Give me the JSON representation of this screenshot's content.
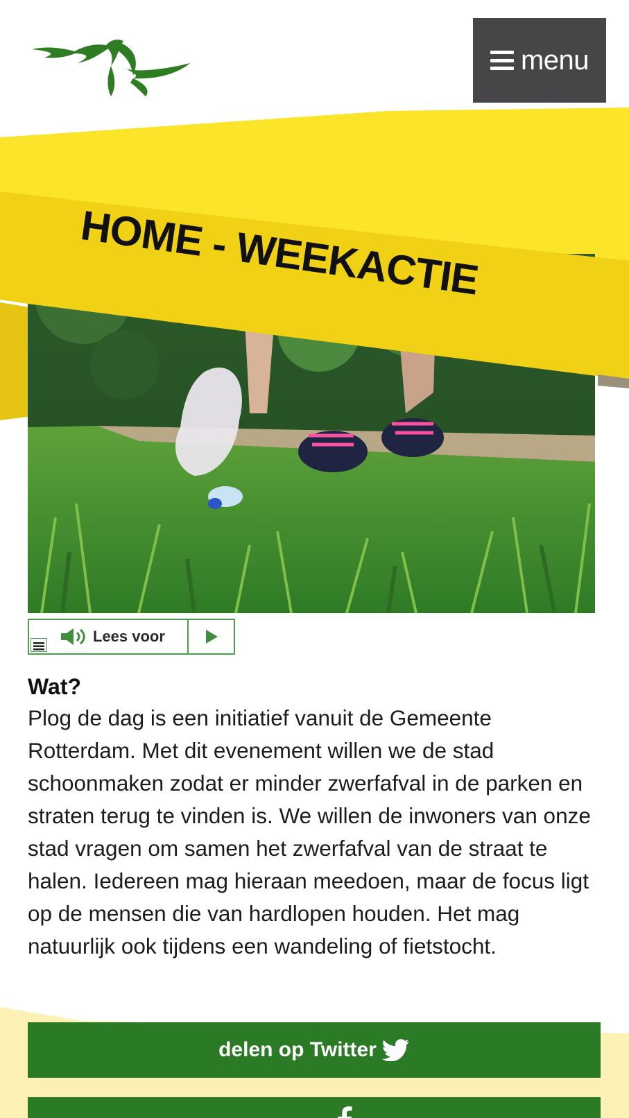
{
  "header": {
    "logo_icon": "gemeente-rotterdam-logo-icon",
    "menu_label": "menu",
    "menu_icon": "hamburger-icon"
  },
  "banner": {
    "title": "HOME - WEEKACTIE",
    "band_color": "#f7d51d"
  },
  "hero": {
    "image": "person-picking-up-plastic-bottle-in-grass-photo"
  },
  "read_aloud": {
    "label": "Lees voor",
    "speaker_icon": "speaker-icon",
    "play_icon": "play-icon",
    "menu_icon": "list-icon"
  },
  "article": {
    "heading": "Wat?",
    "body": "Plog de dag is een initiatief vanuit de Gemeente Rotterdam. Met dit evenement willen we de stad schoonmaken zodat er minder zwerfafval in de parken en straten terug te vinden is. We willen de inwoners van onze stad vragen om samen het zwerfafval van de straat te halen. Iedereen mag hieraan meedoen, maar de focus ligt op de mensen die van hardlopen houden. Het mag natuurlijk ook tijdens een wandeling of fietstocht."
  },
  "share": {
    "twitter_label": "delen op Twitter",
    "twitter_icon": "twitter-bird-icon",
    "facebook_label": "",
    "facebook_icon": "facebook-icon",
    "color": "#2b7a25"
  }
}
